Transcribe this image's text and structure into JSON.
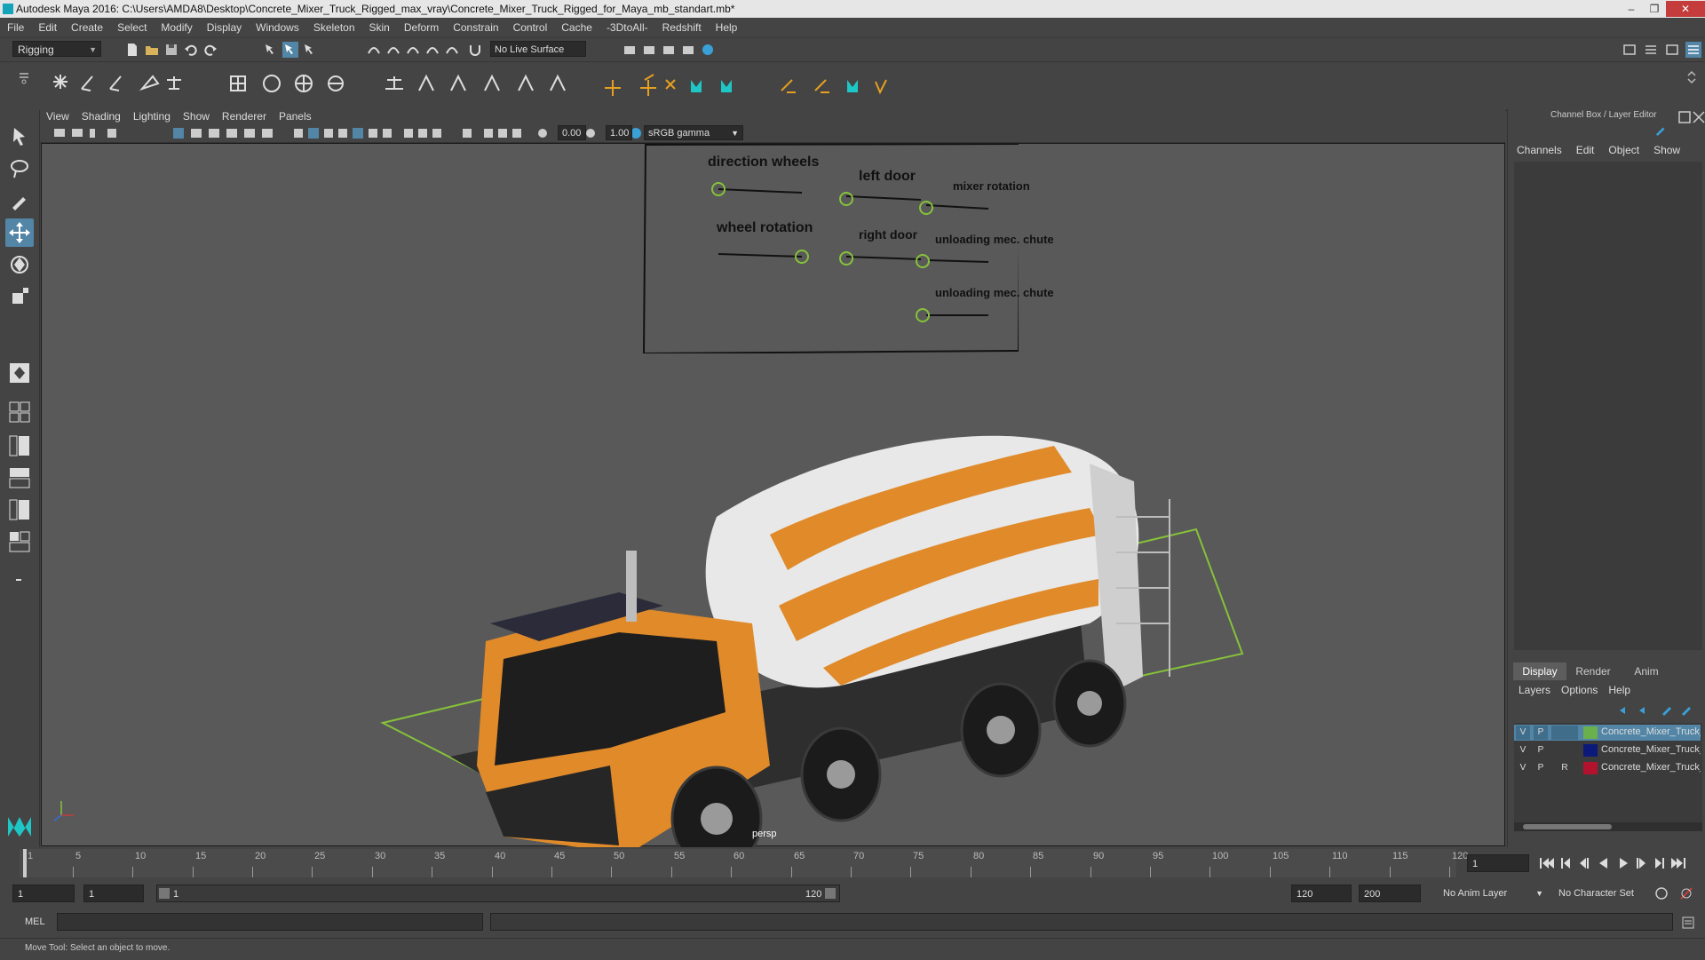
{
  "window": {
    "title": "Autodesk Maya 2016: C:\\Users\\AMDA8\\Desktop\\Concrete_Mixer_Truck_Rigged_max_vray\\Concrete_Mixer_Truck_Rigged_for_Maya_mb_standart.mb*",
    "minimize": "–",
    "maximize": "❐",
    "close": "✕"
  },
  "menubar": [
    "File",
    "Edit",
    "Create",
    "Select",
    "Modify",
    "Display",
    "Windows",
    "Skeleton",
    "Skin",
    "Deform",
    "Constrain",
    "Control",
    "Cache",
    "-3DtoAll-",
    "Redshift",
    "Help"
  ],
  "statusline": {
    "mode": "Rigging",
    "live_surface": "No Live Surface"
  },
  "panel": {
    "menu": [
      "View",
      "Shading",
      "Lighting",
      "Show",
      "Renderer",
      "Panels"
    ],
    "exposure": "0.00",
    "gamma": "1.00",
    "color_space": "sRGB gamma",
    "camera_label": "persp"
  },
  "rig_controls": {
    "direction_wheels": "direction wheels",
    "left_door": "left door",
    "mixer_rotation": "mixer rotation",
    "wheel_rotation": "wheel rotation",
    "right_door": "right door",
    "unloading_chute_1": "unloading mec. chute",
    "unloading_chute_2": "unloading mec. chute"
  },
  "channel_box": {
    "title": "Channel Box / Layer Editor",
    "tabs": [
      "Channels",
      "Edit",
      "Object",
      "Show"
    ],
    "display_tabs": [
      "Display",
      "Render",
      "Anim"
    ],
    "layer_menu": [
      "Layers",
      "Options",
      "Help"
    ],
    "layers": [
      {
        "v": "V",
        "p": "P",
        "r": "",
        "color": "#6ab04c",
        "name": "Concrete_Mixer_Truck_",
        "selected": true
      },
      {
        "v": "V",
        "p": "P",
        "r": "",
        "color": "#0b1a7a",
        "name": "Concrete_Mixer_Truck_",
        "selected": false
      },
      {
        "v": "V",
        "p": "P",
        "r": "R",
        "color": "#b3122e",
        "name": "Concrete_Mixer_Truck_",
        "selected": false
      }
    ]
  },
  "timeline": {
    "ticks": [
      1,
      5,
      10,
      15,
      20,
      25,
      30,
      35,
      40,
      45,
      50,
      55,
      60,
      65,
      70,
      75,
      80,
      85,
      90,
      95,
      100,
      105,
      110,
      115,
      120
    ],
    "current_frame": "1",
    "start": "1",
    "playback_start": "1",
    "range_start_label": "1",
    "range_end_label": "120",
    "playback_end": "120",
    "end": "200",
    "anim_layer": "No Anim Layer",
    "character_set": "No Character Set"
  },
  "command_line": {
    "language": "MEL"
  },
  "help_line": "Move Tool: Select an object to move.",
  "colors": {
    "accent": "#5285a6",
    "maya_teal": "#14a3b8",
    "truck_orange": "#e08a2a",
    "ground_green": "#86c23a"
  }
}
